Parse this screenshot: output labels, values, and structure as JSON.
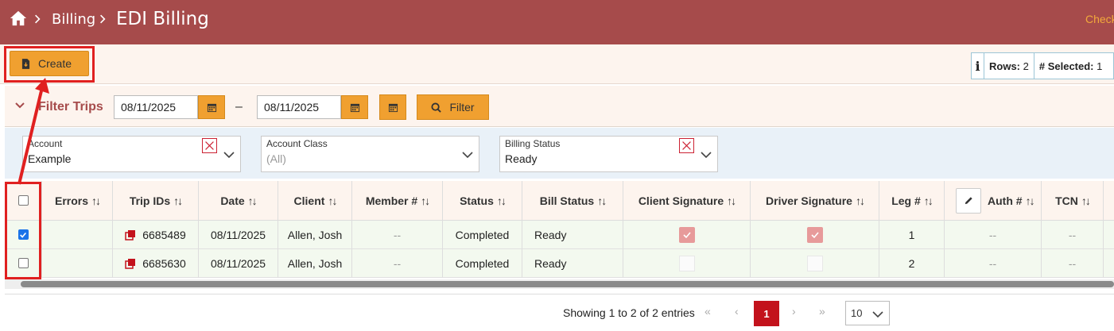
{
  "breadcrumb": {
    "section": "Billing",
    "page": "EDI Billing"
  },
  "header": {
    "right_link": "Check"
  },
  "toolbar": {
    "create_label": "Create"
  },
  "info": {
    "rows_label": "Rows:",
    "rows_value": "2",
    "selected_label": "# Selected:",
    "selected_value": "1"
  },
  "filter": {
    "title": "Filter Trips",
    "start_date": "08/11/2025",
    "dash": "–",
    "end_date": "08/11/2025",
    "filter_label": "Filter"
  },
  "selects": [
    {
      "label": "Account",
      "value": "Example"
    },
    {
      "label": "Account Class",
      "value": "(All)"
    },
    {
      "label": "Billing Status",
      "value": "Ready"
    }
  ],
  "table": {
    "columns": [
      "Errors",
      "Trip IDs",
      "Date",
      "Client",
      "Member #",
      "Status",
      "Bill Status",
      "Client Signature",
      "Driver Signature",
      "Leg #",
      "Auth #",
      "TCN"
    ],
    "rows": [
      {
        "checked": true,
        "errors": "",
        "trip_id": "6685489",
        "date": "08/11/2025",
        "client": "Allen, Josh",
        "member": "--",
        "status": "Completed",
        "bill_status": "Ready",
        "client_sig": true,
        "driver_sig": true,
        "leg": "1",
        "auth": "--",
        "tcn": "--"
      },
      {
        "checked": false,
        "errors": "",
        "trip_id": "6685630",
        "date": "08/11/2025",
        "client": "Allen, Josh",
        "member": "--",
        "status": "Completed",
        "bill_status": "Ready",
        "client_sig": false,
        "driver_sig": false,
        "leg": "2",
        "auth": "--",
        "tcn": "--"
      }
    ]
  },
  "pager": {
    "summary": "Showing 1 to 2 of 2 entries",
    "first": "«",
    "prev": "‹",
    "current_page": "1",
    "next": "›",
    "last": "»",
    "page_size": "10"
  },
  "colors": {
    "header_bg": "#a64b4b",
    "accent": "#f0a030",
    "annotation_red": "#e02020",
    "current_page": "#c3121c"
  },
  "icons": [
    "home-icon",
    "chevron-right-icon",
    "file-download-icon",
    "info-icon",
    "chevron-down-icon",
    "calendar-icon",
    "search-icon",
    "clear-x-icon",
    "sort-icon",
    "copy-icon",
    "check-icon",
    "pencil-icon"
  ]
}
